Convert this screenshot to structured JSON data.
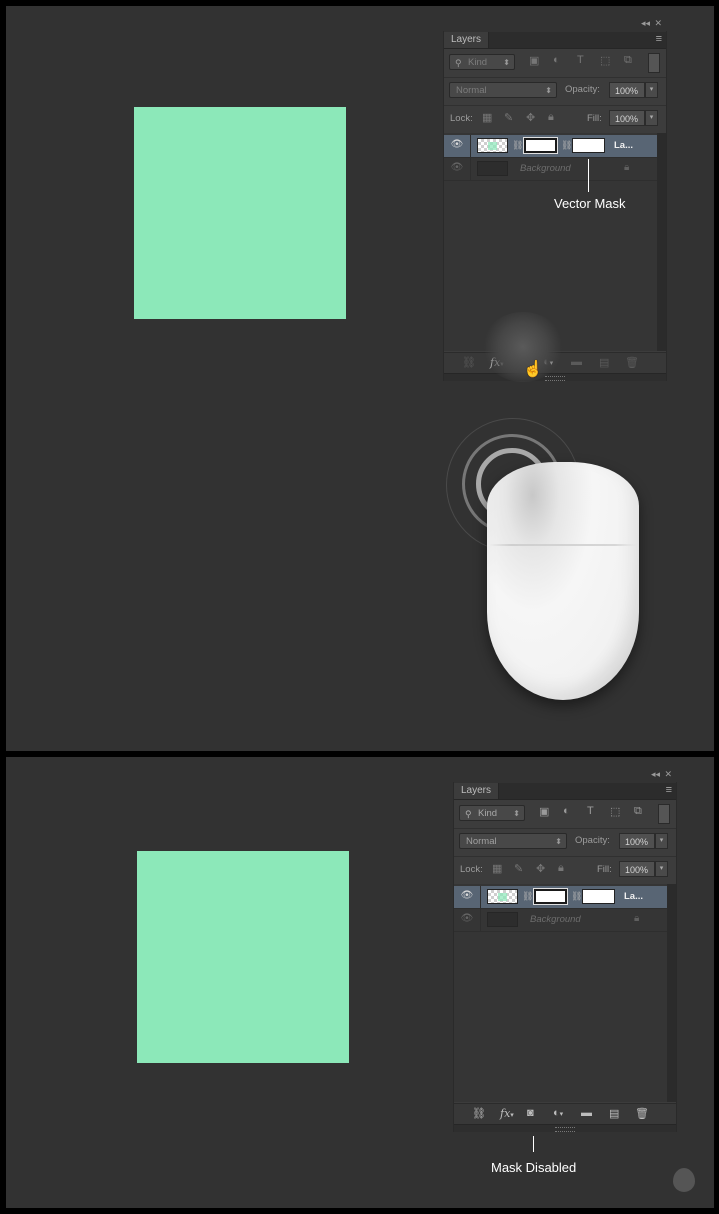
{
  "top_panel": {
    "layers": {
      "tab_label": "Layers",
      "collapse_glyph": "◂◂",
      "close_glyph": "✕",
      "menu_glyph": "≡",
      "filter": {
        "icon": "search-icon",
        "value": "Kind"
      },
      "blend_mode": "Normal",
      "opacity_label": "Opacity:",
      "opacity_value": "100%",
      "lock_label": "Lock:",
      "fill_label": "Fill:",
      "fill_value": "100%",
      "layers": [
        {
          "name": "La...",
          "selected": true
        },
        {
          "name": "Background",
          "selected": false
        }
      ],
      "bottom_icons": [
        "link-icon",
        "fx-icon",
        "add-mask-icon",
        "adjustment-icon",
        "folder-icon",
        "new-layer-icon",
        "trash-icon"
      ],
      "fx_label": "fx"
    },
    "callout": "Vector Mask"
  },
  "bottom_panel": {
    "layers": {
      "tab_label": "Layers",
      "collapse_glyph": "◂◂",
      "close_glyph": "✕",
      "menu_glyph": "≡",
      "filter": {
        "icon": "search-icon",
        "value": "Kind"
      },
      "blend_mode": "Normal",
      "opacity_label": "Opacity:",
      "opacity_value": "100%",
      "lock_label": "Lock:",
      "fill_label": "Fill:",
      "fill_value": "100%",
      "layers": [
        {
          "name": "La...",
          "selected": true
        },
        {
          "name": "Background",
          "selected": false
        }
      ],
      "fx_label": "fx"
    },
    "callout": "Mask Disabled"
  },
  "colors": {
    "canvas": "#323232",
    "shape": "#8ce8b9",
    "selected_layer": "#586574"
  }
}
